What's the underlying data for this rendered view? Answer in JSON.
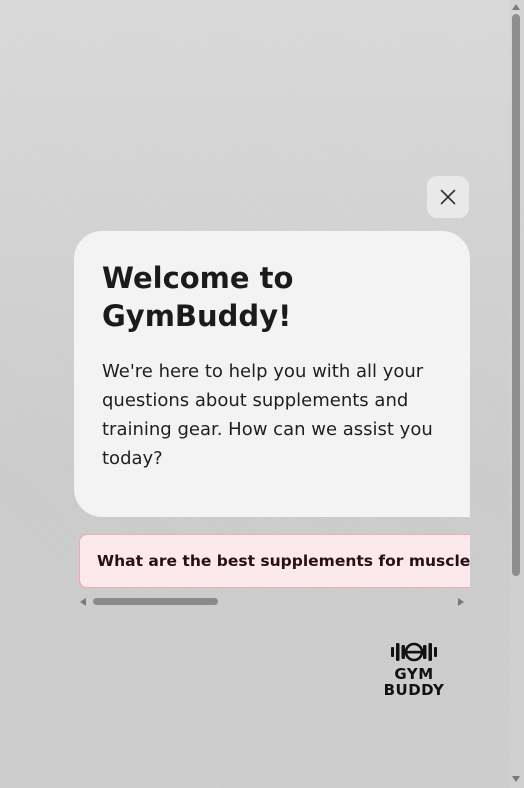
{
  "close_button": {
    "icon": "close-icon"
  },
  "welcome": {
    "title": "Welcome to GymBuddy!",
    "message": "We're here to help you with all your questions about supplements and training gear. How can we assist you today?"
  },
  "suggestions": [
    {
      "label": "What are the best supplements for muscle gain?"
    }
  ],
  "logo": {
    "icon": "dumbbell-icon",
    "line1": "GYM",
    "line2": "BUDDY"
  },
  "colors": {
    "chip_background": "#fbe9ed",
    "chip_border": "#f2a9b8",
    "card_background": "#f3f3f3"
  }
}
